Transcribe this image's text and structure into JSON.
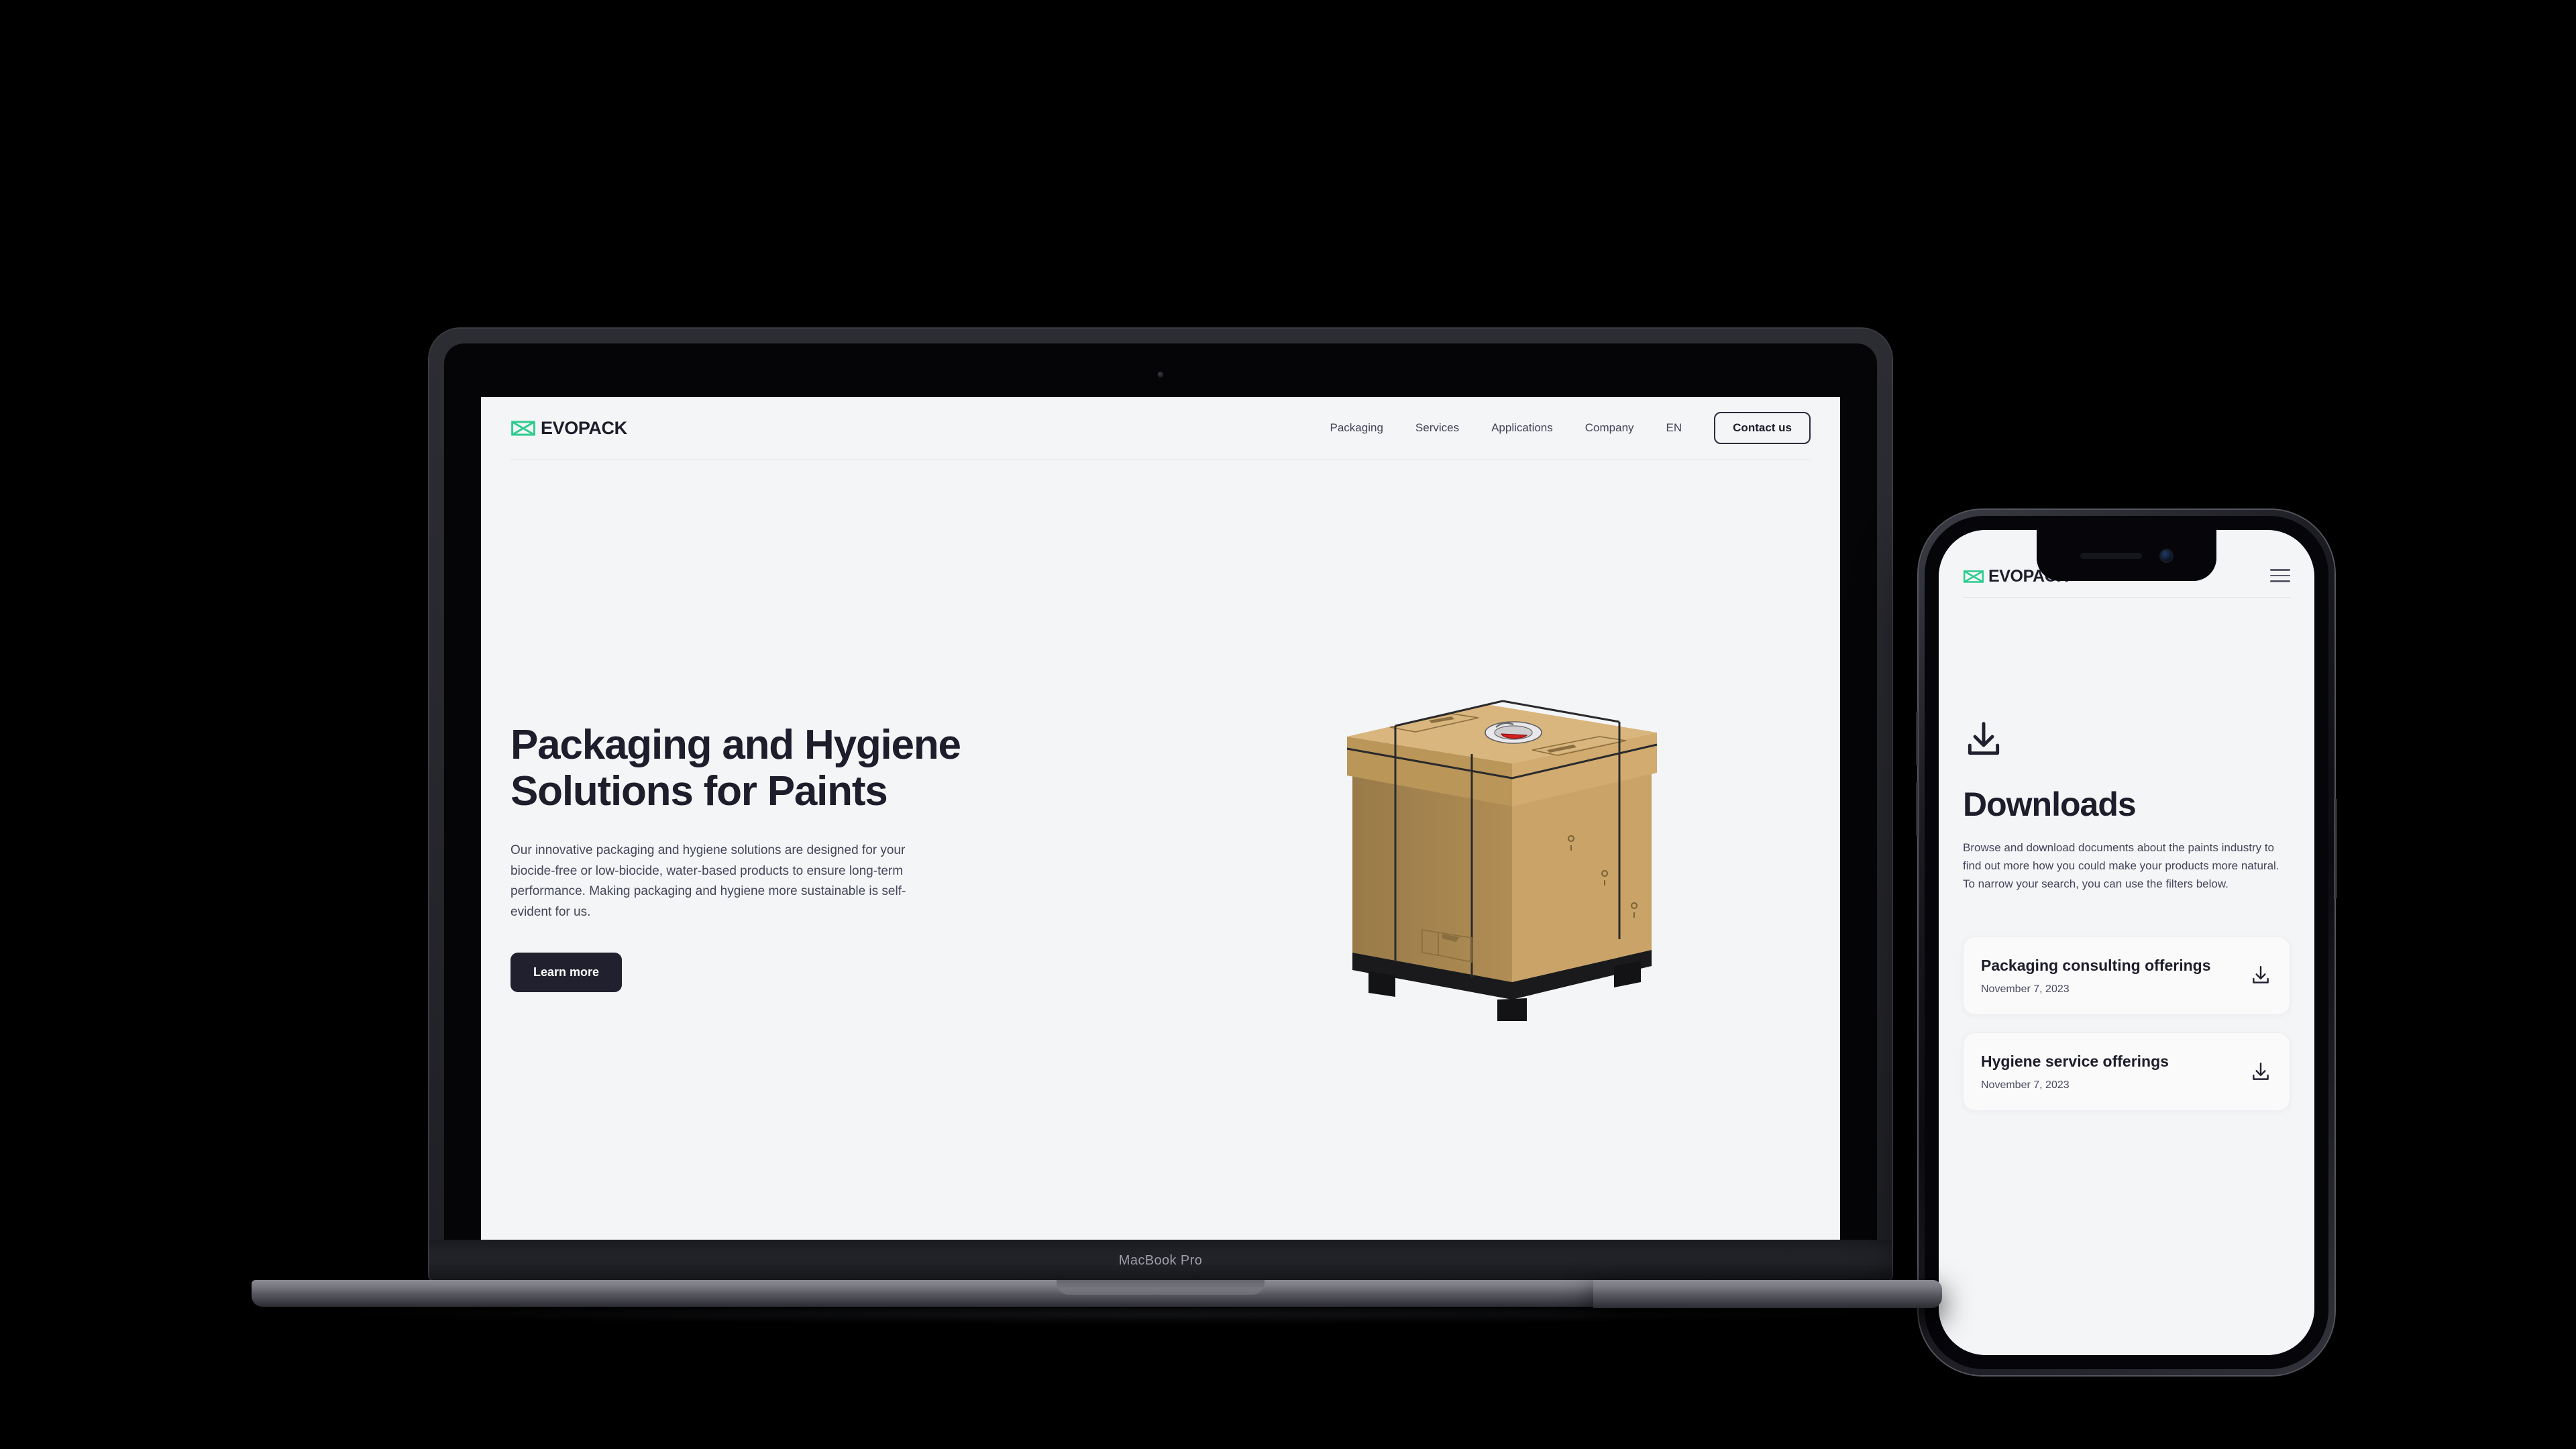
{
  "background_color": "#000000",
  "laptop": {
    "model_label": "MacBook Pro",
    "site": {
      "brand": {
        "name": "EVOPACK",
        "mark_icon": "evopack-bowtie-logo",
        "accent_color": "#2ecc8f"
      },
      "nav": [
        {
          "label": "Packaging"
        },
        {
          "label": "Services"
        },
        {
          "label": "Applications"
        },
        {
          "label": "Company"
        },
        {
          "label": "EN"
        }
      ],
      "contact_button": "Contact us",
      "hero": {
        "title_line1": "Packaging and Hygiene",
        "title_line2": "Solutions for Paints",
        "subtitle": "Our innovative packaging and hygiene solutions are designed for your biocide-free or low-biocide, water-based products to ensure long-term performance. Making packaging and hygiene more sustainable is self-evident for us.",
        "cta_label": "Learn more",
        "image_alt": "corrugated cardboard IBC container on black plastic pallet with red tap"
      },
      "colors": {
        "page_bg": "#f4f5f7",
        "heading": "#1d1d2b",
        "body": "#44455a",
        "cta_bg": "#20202f"
      }
    }
  },
  "phone": {
    "site": {
      "brand": {
        "name": "EVOPACK",
        "mark_icon": "evopack-bowtie-logo"
      },
      "menu_icon": "hamburger-menu-icon",
      "page": {
        "hero_icon": "download-icon",
        "title": "Downloads",
        "description": "Browse and download documents about the paints industry to find out more how you could make your products more natural. To narrow your search, you can use the filters below."
      },
      "downloads": [
        {
          "title": "Packaging consulting offerings",
          "date": "November 7, 2023",
          "icon": "download-icon"
        },
        {
          "title": "Hygiene service offerings",
          "date": "November 7, 2023",
          "icon": "download-icon"
        }
      ]
    }
  }
}
